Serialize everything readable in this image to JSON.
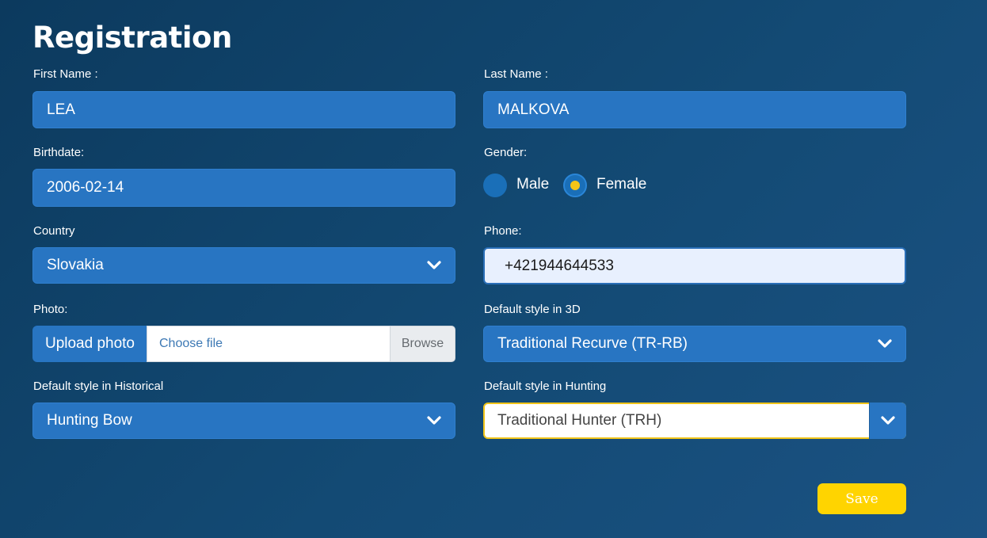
{
  "form": {
    "title": "Registration",
    "first_name": {
      "label": "First Name :",
      "value": "LEA"
    },
    "last_name": {
      "label": "Last Name :",
      "value": "MALKOVA"
    },
    "birthdate": {
      "label": "Birthdate:",
      "value": "2006-02-14"
    },
    "gender": {
      "label": "Gender:",
      "options": [
        {
          "label": "Male",
          "checked": false
        },
        {
          "label": "Female",
          "checked": true
        }
      ]
    },
    "country": {
      "label": "Country",
      "value": "Slovakia"
    },
    "phone": {
      "label": "Phone:",
      "value": "+421944644533"
    },
    "photo": {
      "label": "Photo:",
      "upload_label": "Upload photo",
      "file_placeholder": "Choose file",
      "browse_label": "Browse"
    },
    "style_3d": {
      "label": "Default style in 3D",
      "value": "Traditional Recurve (TR-RB)"
    },
    "style_historical": {
      "label": "Default style in Historical",
      "value": "Hunting Bow"
    },
    "style_hunting": {
      "label": "Default style in Hunting",
      "value": "Traditional Hunter (TRH)"
    },
    "save_label": "Save"
  },
  "colors": {
    "background": "#134a74",
    "field": "#2875c2",
    "accent": "#ffd400",
    "radio_dot": "#f5c518"
  },
  "icons": {
    "select_arrow": "chevron-down-icon"
  }
}
